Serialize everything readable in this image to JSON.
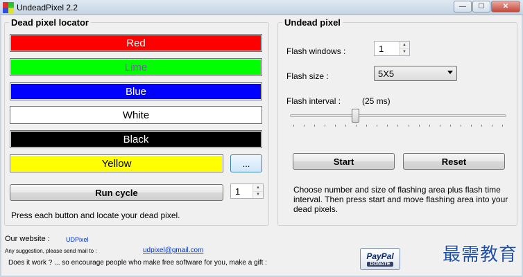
{
  "window": {
    "title": "UndeadPixel 2.2",
    "minimize": "—",
    "maximize": "☐",
    "close": "✕"
  },
  "locator": {
    "title": "Dead pixel locator",
    "colors": [
      {
        "label": "Red",
        "bg": "#ff0000",
        "fg": "#ffffff"
      },
      {
        "label": "Lime",
        "bg": "#00ff00",
        "fg": "#9b3fd8"
      },
      {
        "label": "Blue",
        "bg": "#0000ff",
        "fg": "#ffffff"
      },
      {
        "label": "White",
        "bg": "#ffffff",
        "fg": "#000000"
      },
      {
        "label": "Black",
        "bg": "#000000",
        "fg": "#ffffff"
      },
      {
        "label": "Yellow",
        "bg": "#ffff00",
        "fg": "#000000"
      }
    ],
    "custom_color_button": "...",
    "run_cycle": "Run cycle",
    "cycle_count": "1",
    "hint": "Press each button and locate your dead pixel."
  },
  "undead": {
    "title": "Undead pixel",
    "flash_windows_label": "Flash windows :",
    "flash_windows_value": "1",
    "flash_size_label": "Flash size :",
    "flash_size_value": "5X5",
    "flash_interval_label": "Flash interval :",
    "flash_interval_value": "(25 ms)",
    "slider_level": 0.3,
    "start": "Start",
    "reset": "Reset",
    "description": "Choose number and size of flashing area plus flash time interval. Then press start and move flashing area into your dead pixels."
  },
  "footer": {
    "website_label": "Our website :",
    "website_link": "UDPixel",
    "suggestion_label": "Any suggestion, please send mail to :",
    "email": "udpixel@gmail.com",
    "gift_text": "Does it work ? ... so encourage people who make free software for you, make a gift :",
    "paypal_logo": "PayPal",
    "paypal_donate": "DONATE"
  },
  "watermark": "最需教育"
}
